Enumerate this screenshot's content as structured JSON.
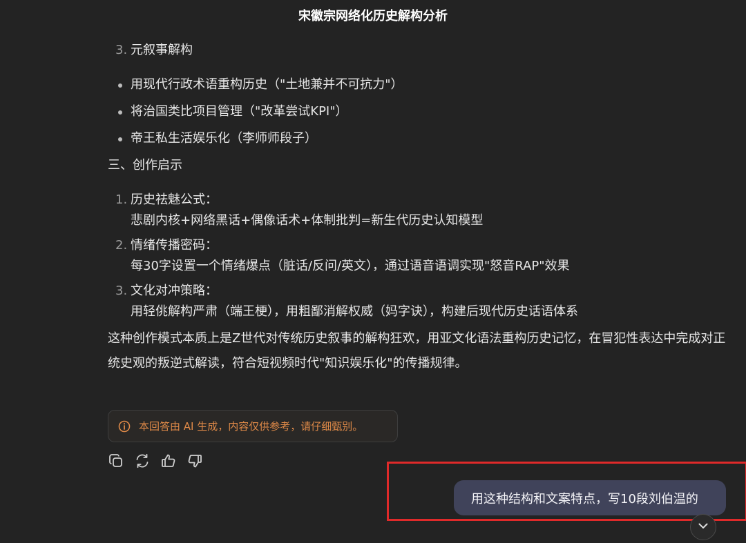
{
  "header": {
    "title": "宋徽宗网络化历史解构分析"
  },
  "section_meta": {
    "item3_number": "3.",
    "item3_label": "元叙事解构",
    "bullets": [
      "用现代行政术语重构历史（\"土地兼并不可抗力\"）",
      "将治国类比项目管理（\"改革尝试KPI\"）",
      "帝王私生活娱乐化（李师师段子）"
    ]
  },
  "section_three": {
    "heading": "三、创作启示",
    "items": [
      {
        "number": "1.",
        "label": "历史祛魅公式：",
        "detail": "悲剧内核+网络黑话+偶像话术+体制批判=新生代历史认知模型"
      },
      {
        "number": "2.",
        "label": "情绪传播密码：",
        "detail": "每30字设置一个情绪爆点（脏话/反问/英文），通过语音语调实现\"怒音RAP\"效果"
      },
      {
        "number": "3.",
        "label": "文化对冲策略：",
        "detail": "用轻佻解构严肃（端王梗），用粗鄙消解权威（妈字诀），构建后现代历史话语体系"
      }
    ]
  },
  "conclusion": "这种创作模式本质上是Z世代对传统历史叙事的解构狂欢，用亚文化语法重构历史记忆，在冒犯性表达中完成对正统史观的叛逆式解读，符合短视频时代\"知识娱乐化\"的传播规律。",
  "notice": {
    "icon": "info-circle-icon",
    "text": "本回答由 AI 生成，内容仅供参考，请仔细甄别。",
    "color": "#e08a48"
  },
  "actions": {
    "icons": [
      "copy-icon",
      "regenerate-icon",
      "thumbs-up-icon",
      "thumbs-down-icon"
    ]
  },
  "user_message": {
    "text": "用这种结构和文案特点，写10段刘伯温的",
    "bubble_color": "#40435a"
  },
  "highlight": {
    "color": "#e02a2a"
  },
  "scroll_button": {
    "icon": "chevron-down-icon"
  }
}
